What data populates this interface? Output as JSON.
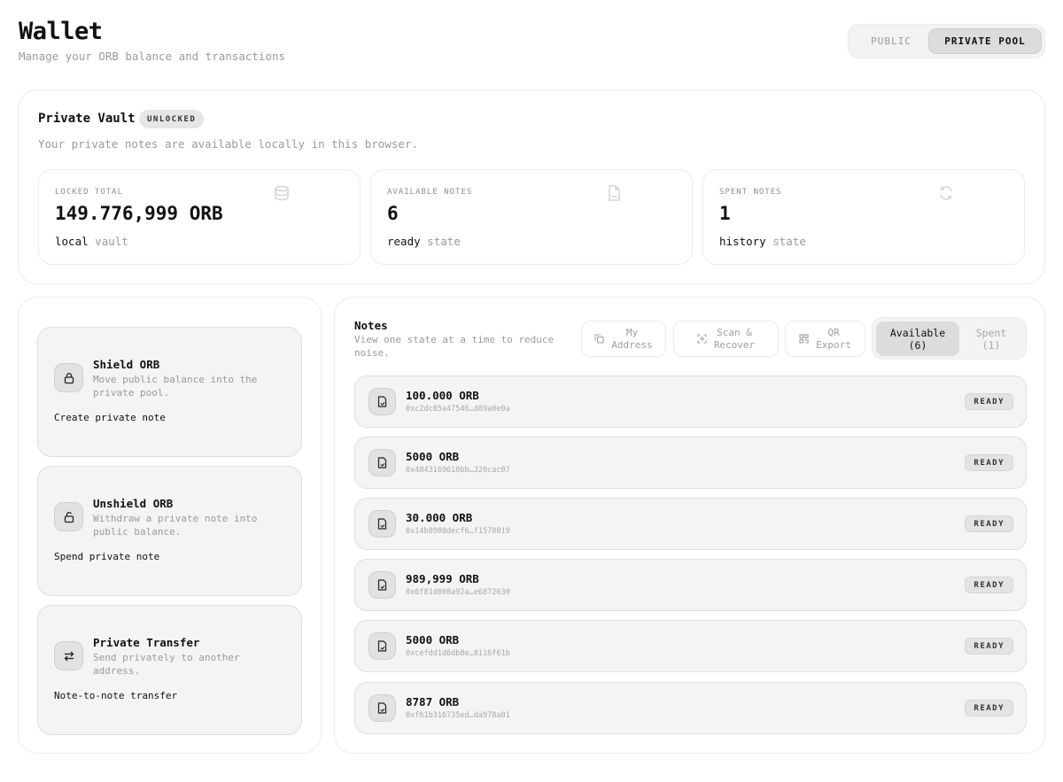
{
  "header": {
    "title": "Wallet",
    "subtitle": "Manage your ORB balance and transactions"
  },
  "mode_toggle": {
    "public_label": "PUBLIC",
    "private_label": "PRIVATE POOL",
    "active": "private"
  },
  "vault": {
    "title": "Private Vault",
    "badge": "UNLOCKED",
    "description": "Your private notes are available locally in this browser.",
    "stats": [
      {
        "label": "LOCKED TOTAL",
        "value": "149.776,999 ORB",
        "foot_strong": "local",
        "foot_muted": "vault",
        "icon": "database-icon"
      },
      {
        "label": "AVAILABLE NOTES",
        "value": "6",
        "foot_strong": "ready",
        "foot_muted": "state",
        "icon": "document-icon"
      },
      {
        "label": "SPENT NOTES",
        "value": "1",
        "foot_strong": "history",
        "foot_muted": "state",
        "icon": "refresh-icon"
      }
    ]
  },
  "actions": [
    {
      "title": "Shield ORB",
      "description": "Move public balance into the private pool.",
      "foot": "Create private note",
      "icon": "lock-icon"
    },
    {
      "title": "Unshield ORB",
      "description": "Withdraw a private note into public balance.",
      "foot": "Spend private note",
      "icon": "unlock-icon"
    },
    {
      "title": "Private Transfer",
      "description": "Send privately to another address.",
      "foot": "Note-to-note transfer",
      "icon": "transfer-icon"
    }
  ],
  "notes": {
    "title": "Notes",
    "subtitle": "View one state at a time to reduce noise.",
    "tools": [
      {
        "line1": "My",
        "line2": "Address",
        "icon": "copy-icon"
      },
      {
        "line1": "Scan &",
        "line2": "Recover",
        "icon": "scan-icon"
      },
      {
        "line1": "QR",
        "line2": "Export",
        "icon": "qr-icon"
      }
    ],
    "state_toggle": {
      "available_line1": "Available",
      "available_line2": "(6)",
      "spent_line1": "Spent",
      "spent_line2": "(1)",
      "active": "available"
    },
    "items": [
      {
        "amount": "100.000 ORB",
        "hash": "0xc2dc85a47546…d89a0e0a",
        "status": "READY"
      },
      {
        "amount": "5000 ORB",
        "hash": "0x4843169618bb…320cac07",
        "status": "READY"
      },
      {
        "amount": "30.000 ORB",
        "hash": "0x14b8908decf6…f1578019",
        "status": "READY"
      },
      {
        "amount": "989,999 ORB",
        "hash": "0x6f81d008a92a…e6872630",
        "status": "READY"
      },
      {
        "amount": "5000 ORB",
        "hash": "0xcefdd1d6db8e…8116f61b",
        "status": "READY"
      },
      {
        "amount": "8787 ORB",
        "hash": "0xf61b316735ed…da978a01",
        "status": "READY"
      }
    ]
  }
}
